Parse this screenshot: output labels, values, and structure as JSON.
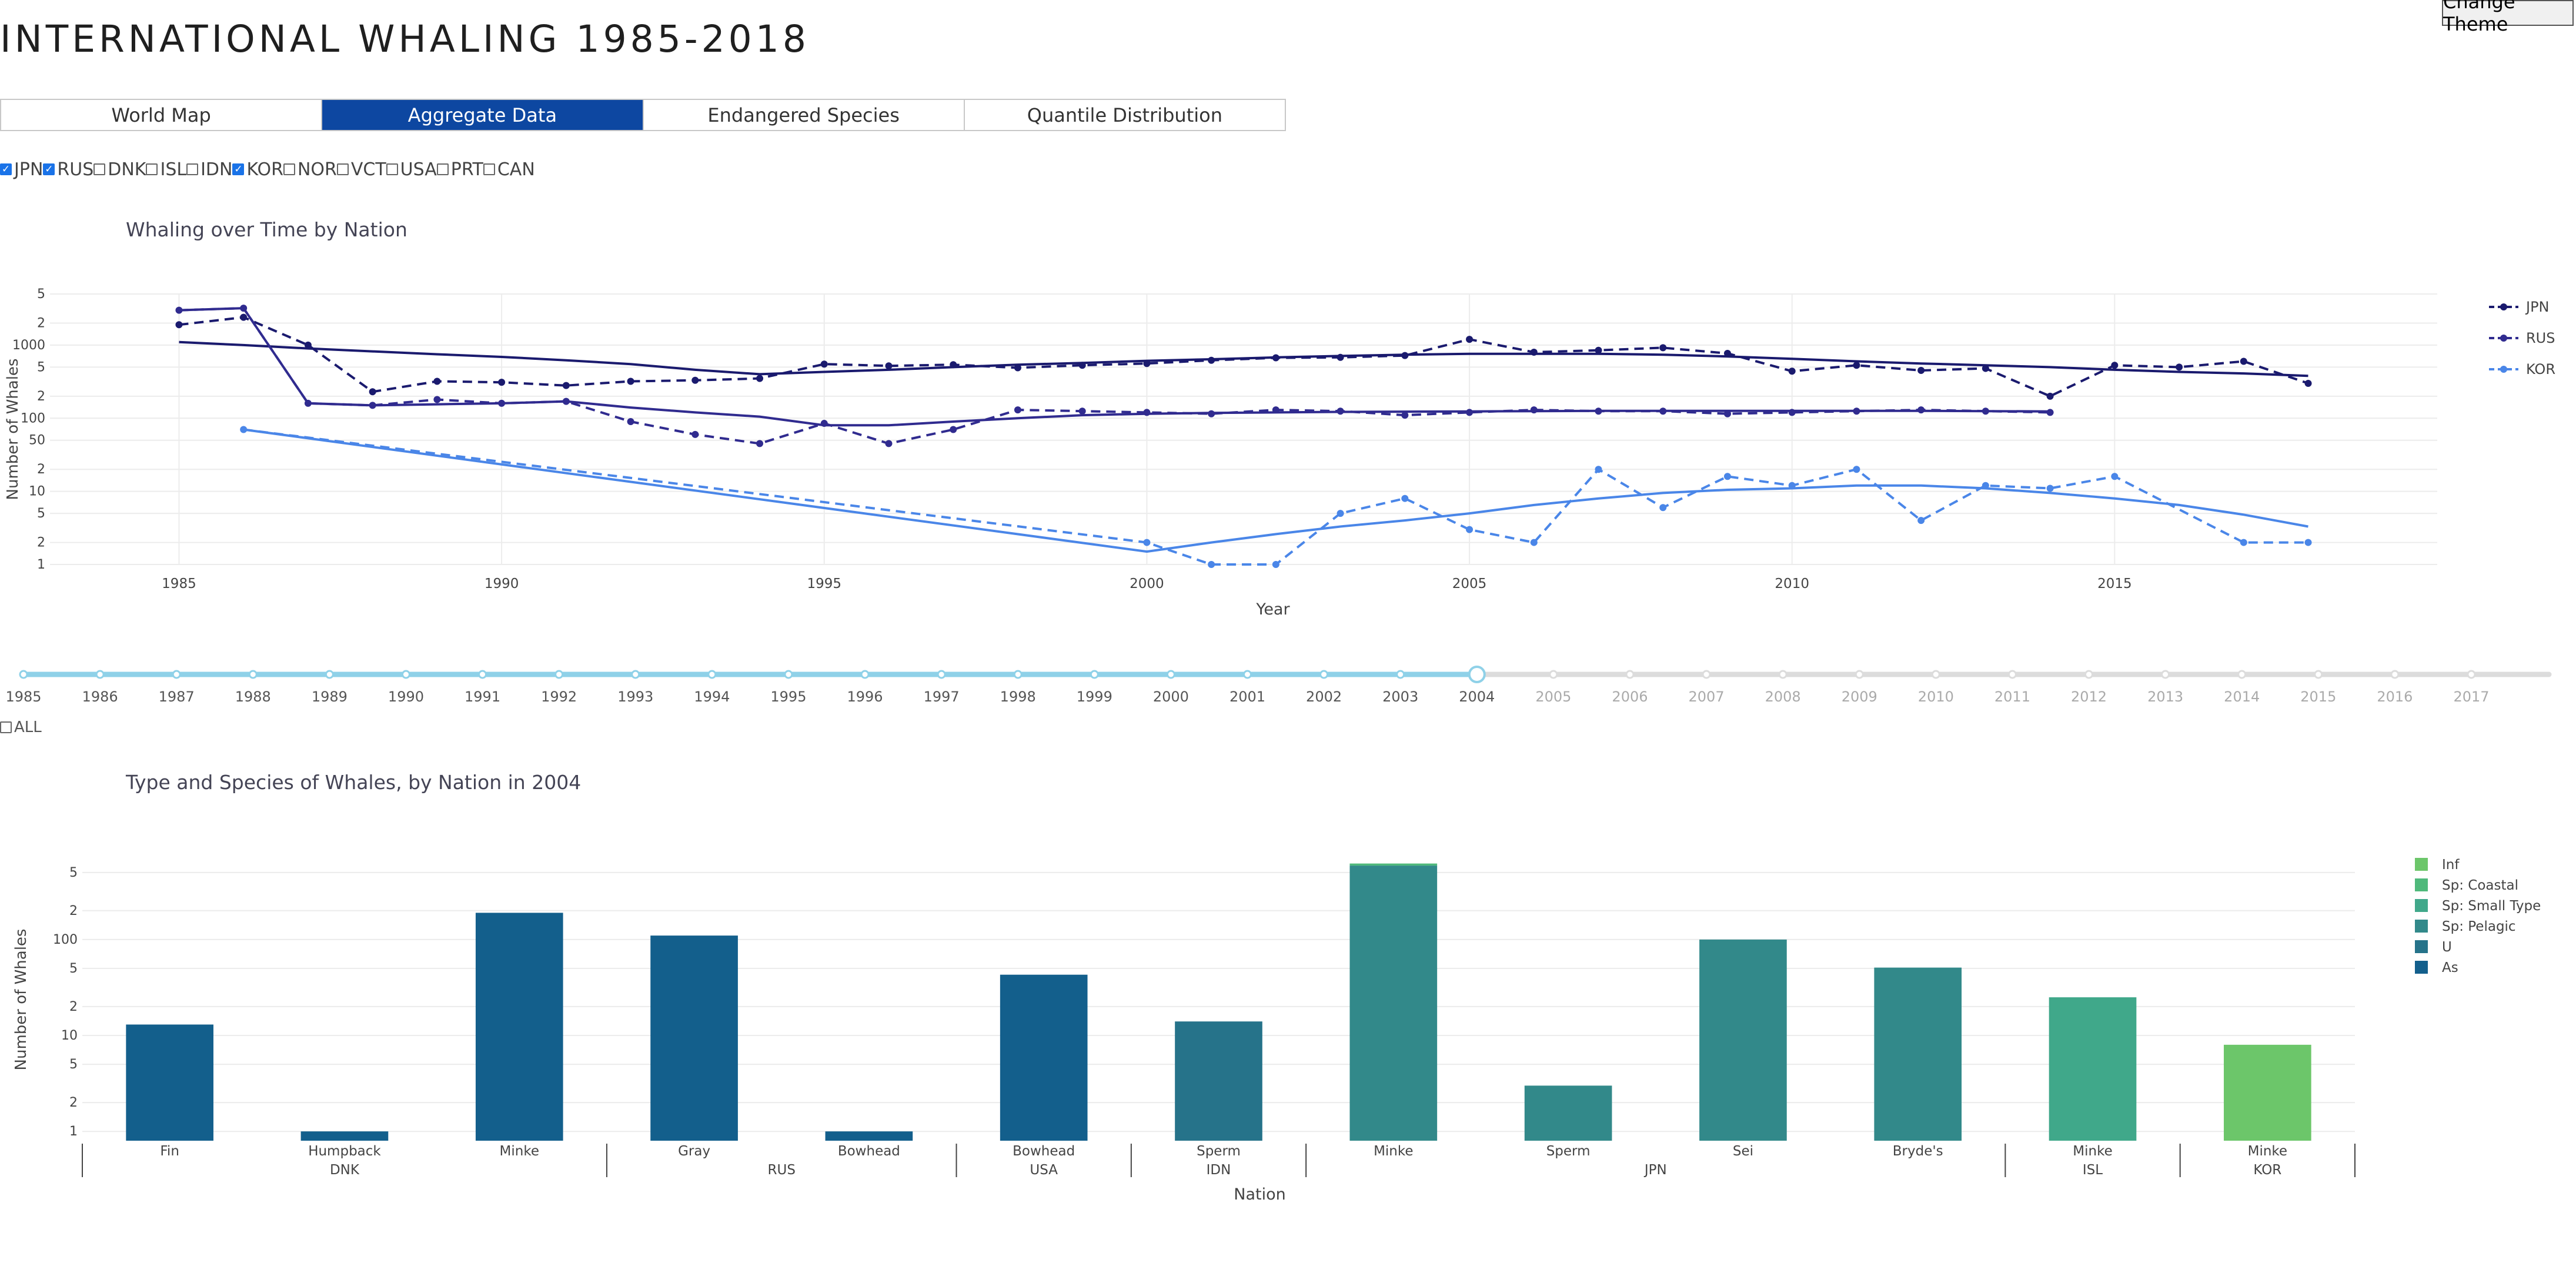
{
  "page": {
    "title": "INTERNATIONAL WHALING 1985-2018",
    "theme_button": "Change Theme",
    "tabs": [
      {
        "label": "World Map",
        "active": false
      },
      {
        "label": "Aggregate Data",
        "active": true
      },
      {
        "label": "Endangered Species",
        "active": false
      },
      {
        "label": "Quantile Distribution",
        "active": false
      }
    ],
    "nations": [
      {
        "code": "JPN",
        "checked": true
      },
      {
        "code": "RUS",
        "checked": true
      },
      {
        "code": "DNK",
        "checked": false
      },
      {
        "code": "ISL",
        "checked": false
      },
      {
        "code": "IDN",
        "checked": false
      },
      {
        "code": "KOR",
        "checked": true
      },
      {
        "code": "NOR",
        "checked": false
      },
      {
        "code": "VCT",
        "checked": false
      },
      {
        "code": "USA",
        "checked": false
      },
      {
        "code": "PRT",
        "checked": false
      },
      {
        "code": "CAN",
        "checked": false
      }
    ],
    "slider": {
      "years": [
        "1985",
        "1986",
        "1987",
        "1988",
        "1989",
        "1990",
        "1991",
        "1992",
        "1993",
        "1994",
        "1995",
        "1996",
        "1997",
        "1998",
        "1999",
        "2000",
        "2001",
        "2002",
        "2003",
        "2004",
        "2005",
        "2006",
        "2007",
        "2008",
        "2009",
        "2010",
        "2011",
        "2012",
        "2013",
        "2014",
        "2015",
        "2016",
        "2017"
      ],
      "selected": "2004",
      "all_label": "ALL",
      "all_checked": false
    }
  },
  "chart_data": [
    {
      "type": "line",
      "title": "Whaling over Time by Nation",
      "xlabel": "Year",
      "ylabel": "Number of Whales",
      "yscale": "log",
      "xlim": [
        1983,
        2020
      ],
      "ylim": [
        1,
        5000
      ],
      "x_ticks": [
        "1985",
        "1990",
        "1995",
        "2000",
        "2005",
        "2010",
        "2015"
      ],
      "y_ticks": [
        {
          "v": 1,
          "label": "1"
        },
        {
          "v": 2,
          "label": "2"
        },
        {
          "v": 5,
          "label": "5"
        },
        {
          "v": 10,
          "label": "10"
        },
        {
          "v": 20,
          "label": "2"
        },
        {
          "v": 50,
          "label": "50"
        },
        {
          "v": 100,
          "label": "100"
        },
        {
          "v": 200,
          "label": "2"
        },
        {
          "v": 500,
          "label": "5"
        },
        {
          "v": 1000,
          "label": "1000"
        },
        {
          "v": 2000,
          "label": "2"
        },
        {
          "v": 5000,
          "label": "5"
        }
      ],
      "legend_position": "right",
      "series": [
        {
          "name": "JPN",
          "color": "#1a1a6e",
          "x": [
            1985,
            1986,
            1987,
            1988,
            1989,
            1990,
            1991,
            1992,
            1993,
            1994,
            1995,
            1996,
            1997,
            1998,
            1999,
            2000,
            2001,
            2002,
            2003,
            2004,
            2005,
            2006,
            2007,
            2008,
            2009,
            2010,
            2011,
            2012,
            2013,
            2014,
            2015,
            2016,
            2017,
            2018
          ],
          "y": [
            1900,
            2400,
            1000,
            230,
            320,
            310,
            280,
            320,
            330,
            350,
            550,
            520,
            540,
            490,
            530,
            560,
            620,
            670,
            680,
            720,
            1200,
            800,
            850,
            920,
            770,
            440,
            530,
            450,
            480,
            200,
            530,
            500,
            600,
            300
          ],
          "trend": [
            1100,
            1000,
            900,
            820,
            750,
            690,
            620,
            550,
            460,
            400,
            430,
            460,
            500,
            540,
            570,
            610,
            640,
            680,
            710,
            740,
            760,
            760,
            760,
            740,
            700,
            650,
            600,
            560,
            530,
            500,
            460,
            430,
            410,
            380
          ]
        },
        {
          "name": "RUS",
          "color": "#302b8f",
          "x": [
            1985,
            1986,
            1987,
            1988,
            1989,
            1990,
            1991,
            1992,
            1993,
            1994,
            1995,
            1996,
            1997,
            1998,
            1999,
            2000,
            2001,
            2002,
            2003,
            2004,
            2005,
            2006,
            2007,
            2008,
            2009,
            2010,
            2011,
            2012,
            2013,
            2014,
            2015,
            2016,
            2017,
            2018
          ],
          "y": [
            3000,
            3200,
            160,
            150,
            180,
            160,
            170,
            90,
            60,
            45,
            85,
            45,
            70,
            130,
            125,
            120,
            115,
            130,
            125,
            110,
            120,
            130,
            125,
            125,
            115,
            120,
            125,
            130,
            125,
            120,
            null,
            null,
            null,
            null
          ],
          "y_solid": [
            3000,
            3200,
            160,
            150,
            155,
            160,
            170,
            140,
            120,
            105,
            80,
            80,
            90,
            100,
            110,
            115,
            118,
            120,
            122,
            123,
            124,
            125,
            126,
            126,
            126,
            126,
            126,
            126,
            125,
            124,
            null,
            null,
            null,
            null
          ],
          "trend": null
        },
        {
          "name": "KOR",
          "color": "#4a86e8",
          "x": [
            1986,
            2000,
            2001,
            2002,
            2003,
            2004,
            2005,
            2006,
            2007,
            2008,
            2009,
            2010,
            2011,
            2012,
            2013,
            2014,
            2015,
            2016,
            2017,
            2018
          ],
          "y": [
            70,
            2,
            1,
            1,
            5,
            8,
            3,
            2,
            20,
            6,
            16,
            12,
            20,
            4,
            12,
            11,
            16,
            null,
            2,
            2
          ],
          "trend": [
            70,
            1.5,
            2,
            2.6,
            3.3,
            4,
            5,
            6.5,
            8,
            9.5,
            10.5,
            11,
            12,
            12,
            11,
            9.5,
            8,
            6.5,
            4.8,
            3.3
          ]
        }
      ]
    },
    {
      "type": "bar",
      "title": "Type and Species of Whales, by Nation in 2004",
      "xlabel": "Nation",
      "ylabel": "Number of Whales",
      "yscale": "log",
      "ylim": [
        0.8,
        700
      ],
      "y_ticks": [
        {
          "v": 1,
          "label": "1"
        },
        {
          "v": 2,
          "label": "2"
        },
        {
          "v": 5,
          "label": "5"
        },
        {
          "v": 10,
          "label": "10"
        },
        {
          "v": 20,
          "label": "2"
        },
        {
          "v": 50,
          "label": "5"
        },
        {
          "v": 100,
          "label": "100"
        },
        {
          "v": 200,
          "label": "2"
        },
        {
          "v": 500,
          "label": "5"
        }
      ],
      "legend_position": "right",
      "legend": [
        {
          "name": "Inf",
          "color": "#6cc66a"
        },
        {
          "name": "Sp: Coastal",
          "color": "#4fb97b"
        },
        {
          "name": "Sp: Small Type",
          "color": "#40a88a"
        },
        {
          "name": "Sp: Pelagic",
          "color": "#32898a"
        },
        {
          "name": "U",
          "color": "#26738a"
        },
        {
          "name": "As",
          "color": "#135f8c"
        }
      ],
      "groups": [
        {
          "nation": "DNK",
          "bars": [
            {
              "species": "Fin",
              "value": 13,
              "type": "As"
            },
            {
              "species": "Humpback",
              "value": 1,
              "type": "As"
            },
            {
              "species": "Minke",
              "value": 190,
              "type": "As"
            }
          ]
        },
        {
          "nation": "RUS",
          "bars": [
            {
              "species": "Gray",
              "value": 110,
              "type": "As"
            },
            {
              "species": "Bowhead",
              "value": 1,
              "type": "As"
            }
          ]
        },
        {
          "nation": "USA",
          "bars": [
            {
              "species": "Bowhead",
              "value": 43,
              "type": "As"
            }
          ]
        },
        {
          "nation": "IDN",
          "bars": [
            {
              "species": "Sperm",
              "value": 14,
              "type": "U"
            }
          ]
        },
        {
          "nation": "JPN",
          "bars": [
            {
              "species": "Minke",
              "value": 590,
              "type": "Sp: Pelagic",
              "extra": {
                "value": 30,
                "type": "Sp: Coastal"
              }
            },
            {
              "species": "Sperm",
              "value": 3,
              "type": "Sp: Pelagic"
            },
            {
              "species": "Sei",
              "value": 100,
              "type": "Sp: Pelagic"
            },
            {
              "species": "Bryde's",
              "value": 51,
              "type": "Sp: Pelagic"
            }
          ]
        },
        {
          "nation": "ISL",
          "bars": [
            {
              "species": "Minke",
              "value": 25,
              "type": "Sp: Small Type"
            }
          ]
        },
        {
          "nation": "KOR",
          "bars": [
            {
              "species": "Minke",
              "value": 8,
              "type": "Inf"
            }
          ]
        }
      ]
    }
  ]
}
